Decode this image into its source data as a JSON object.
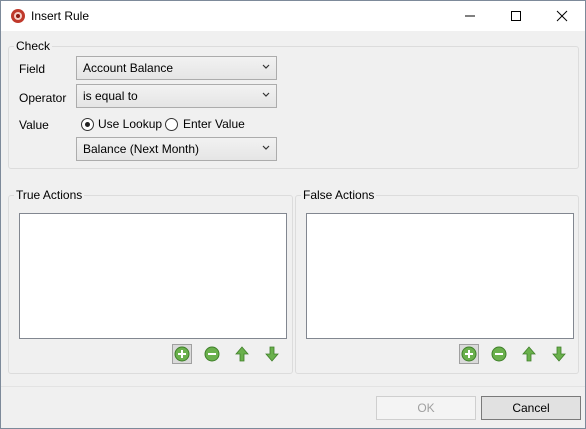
{
  "window": {
    "title": "Insert Rule",
    "app_icon": "app-logo-icon"
  },
  "check": {
    "group_label": "Check",
    "field_label": "Field",
    "field_value": "Account Balance",
    "operator_label": "Operator",
    "operator_value": "is equal to",
    "value_label": "Value",
    "use_lookup_label": "Use Lookup",
    "enter_value_label": "Enter Value",
    "selected_mode": "Use Lookup",
    "lookup_value": "Balance (Next Month)"
  },
  "true_actions": {
    "group_label": "True Actions"
  },
  "false_actions": {
    "group_label": "False Actions"
  },
  "buttons": {
    "ok_label": "OK",
    "cancel_label": "Cancel"
  },
  "colors": {
    "icon_green": "#6ab04c",
    "icon_green_dark": "#3f7f2a"
  }
}
